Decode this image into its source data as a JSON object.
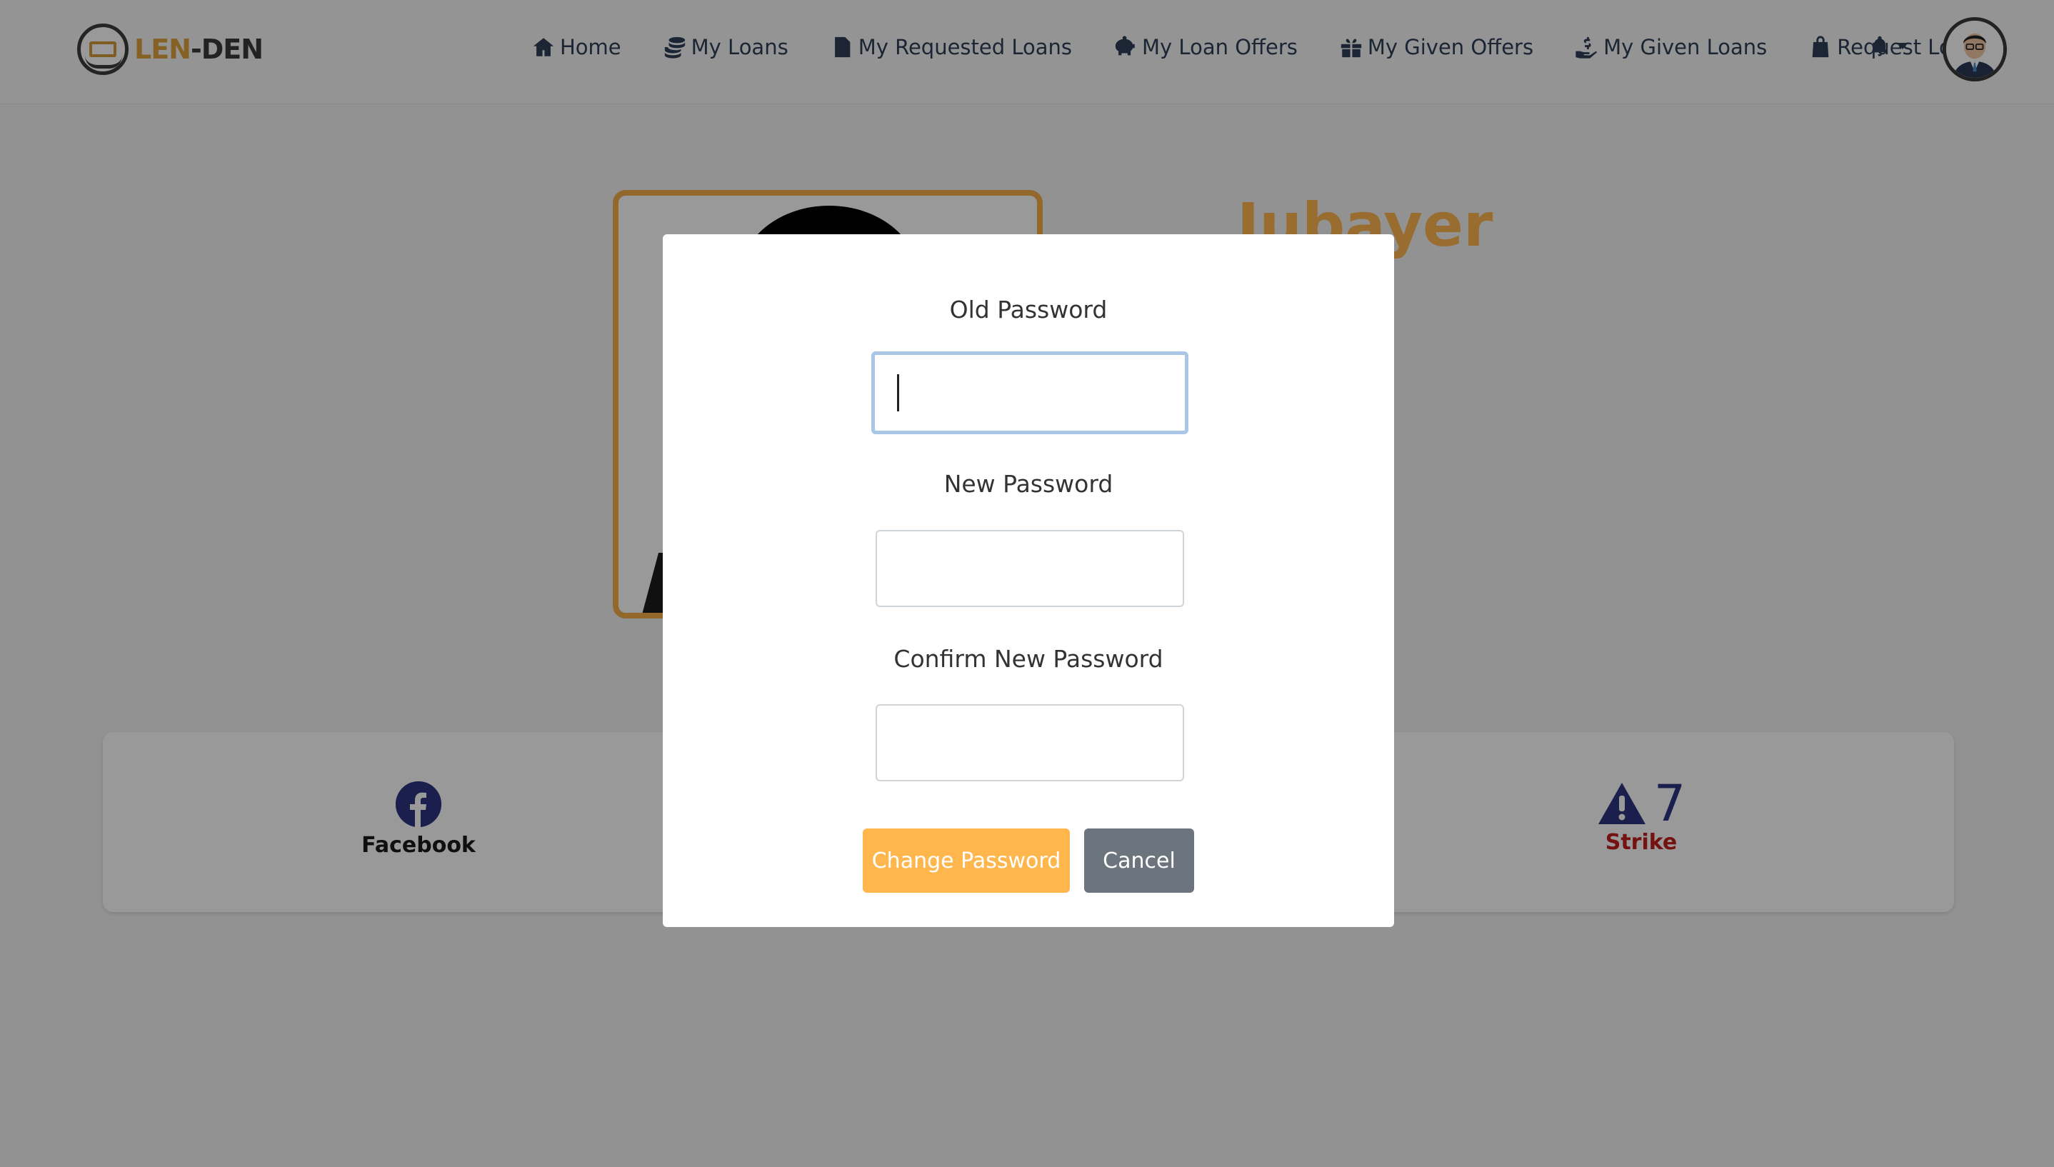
{
  "brand": {
    "part1": "LEN",
    "dash": "-",
    "part2": "DEN"
  },
  "nav": {
    "items": [
      {
        "label": "Home",
        "icon": "home-icon"
      },
      {
        "label": "My Loans",
        "icon": "coins-icon"
      },
      {
        "label": "My Requested Loans",
        "icon": "file-invoice-icon"
      },
      {
        "label": "My Loan Offers",
        "icon": "piggy-bank-icon"
      },
      {
        "label": "My Given Offers",
        "icon": "gifts-icon"
      },
      {
        "label": "My Given Loans",
        "icon": "hand-holding-dollar-icon"
      },
      {
        "label": "Request Loan",
        "icon": "shopping-bag-icon"
      }
    ]
  },
  "profile": {
    "name": "Jubayer"
  },
  "info": {
    "facebook_label": "Facebook",
    "strike_count": "7",
    "strike_label": "Strike"
  },
  "modal": {
    "old_password_label": "Old Password",
    "old_password_value": "",
    "new_password_label": "New Password",
    "new_password_value": "",
    "confirm_password_label": "Confirm New Password",
    "confirm_password_value": "",
    "change_button": "Change Password",
    "cancel_button": "Cancel"
  },
  "colors": {
    "accent": "#ffb74d",
    "nav_text": "#2d3e58",
    "cancel": "#6c757d",
    "strike": "#c21d1d"
  }
}
